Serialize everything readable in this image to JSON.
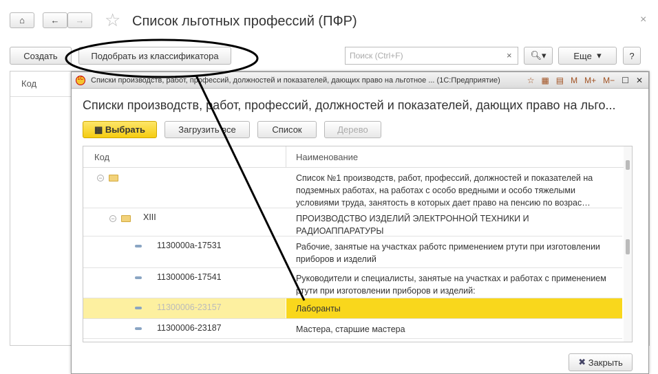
{
  "window": {
    "title": "Список льготных профессий (ПФР)"
  },
  "toolbar": {
    "create": "Создать",
    "pick": "Подобрать из классификатора",
    "search_placeholder": "Поиск (Ctrl+F)",
    "more": "Еще",
    "help": "?"
  },
  "list": {
    "col_code": "Код"
  },
  "modal": {
    "window_title": "Списки производств, работ, профессий, должностей и показателей, дающих право на льготное ... (1С:Предприятие)",
    "heading": "Списки производств, работ, профессий, должностей и показателей, дающих право на льго...",
    "buttons": {
      "select": "Выбрать",
      "load_all": "Загрузить все",
      "list": "Список",
      "tree": "Дерево",
      "close": "Закрыть"
    },
    "mem": [
      "M",
      "M+",
      "M−"
    ],
    "columns": {
      "code": "Код",
      "name": "Наименование"
    },
    "rows": [
      {
        "code": "",
        "name": "Список №1 производств, работ, профессий, должностей и показателей на подземных работах, на работах с особо вредными и особо тяжелыми условиями труда, занятость в которых дает право на пенсию по возрас…"
      },
      {
        "code": "XIII",
        "name": "ПРОИЗВОДСТВО ИЗДЕЛИЙ ЭЛЕКТРОННОЙ ТЕХНИКИ И РАДИОАППАРАТУРЫ"
      },
      {
        "code": "1130000а-17531",
        "name": "Рабочие, занятые на участках работс применением ртути при изготовлении приборов и изделий"
      },
      {
        "code": "11300006-17541",
        "name": "Руководители и специалисты, занятые на участках и работах с применением ртути при изготовлении приборов и изделий:"
      },
      {
        "code": "11300006-23157",
        "name": "Лаборанты"
      },
      {
        "code": "11300006-23187",
        "name": "Мастера, старшие мастера"
      }
    ]
  },
  "colors": {
    "accent": "#f9d71c",
    "selected_row": "#fdf0a0"
  }
}
